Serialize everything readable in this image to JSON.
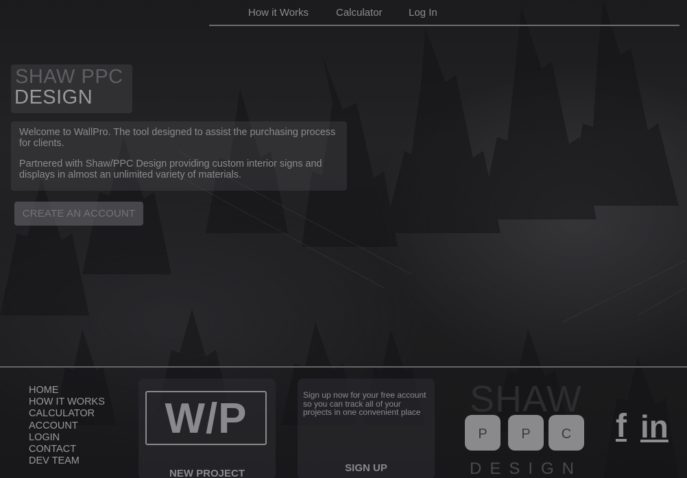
{
  "nav": {
    "items": [
      {
        "label": "How it Works"
      },
      {
        "label": "Calculator"
      },
      {
        "label": "Log In"
      }
    ]
  },
  "hero": {
    "brand_line1": "SHAW PPC",
    "brand_line2": "DESIGN",
    "intro_p1": "Welcome to WallPro. The tool designed to assist the purchasing process for clients.",
    "intro_p2": "Partnered with Shaw/PPC Design providing custom interior signs and displays in almost an unlimited variety of materials.",
    "cta_label": "CREATE AN ACCOUNT"
  },
  "footer": {
    "links": [
      "HOME",
      "HOW IT WORKS",
      "CALCULATOR",
      "ACCOUNT",
      "LOGIN",
      "CONTACT",
      "DEV TEAM"
    ],
    "new_project": {
      "logo_text": "W/P",
      "label": "NEW PROJECT"
    },
    "signup": {
      "text": "Sign up now for your free account so you can track all of your projects in one convenient place",
      "label": "SIGN UP"
    },
    "shaw_logo": {
      "top": "SHAW",
      "letters": [
        "P",
        "P",
        "C"
      ],
      "bottom": "DESIGN"
    },
    "social": {
      "facebook_icon": "facebook-icon",
      "linkedin_icon": "linkedin-icon",
      "facebook_glyph": "f",
      "linkedin_glyph": "in"
    }
  },
  "colors": {
    "background": "#1e1e20",
    "text": "#8c8c8e",
    "divider": "#6e6e70"
  }
}
